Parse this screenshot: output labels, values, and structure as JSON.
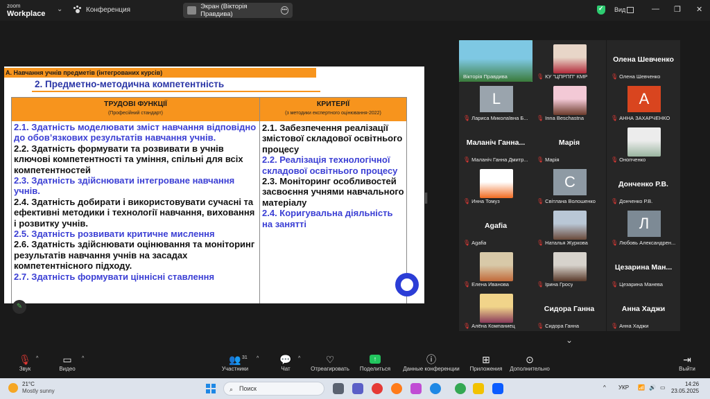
{
  "titlebar": {
    "brand_top": "zoom",
    "brand_bottom": "Workplace",
    "meeting_label": "Конференция",
    "screen_share_label": "Экран (Вікторія Правдива)",
    "view_label": "Вид"
  },
  "slide": {
    "section_title": "А. Навчання учнів предметів (інтегрованих курсів)",
    "subtitle": "2. Предметно-методична компетентність",
    "col1_header": "ТРУДОВІ ФУНКЦІЇ",
    "col1_subheader": "(Професійний стандарт)",
    "col2_header": "КРИТЕРІЇ",
    "col2_subheader": "(з методики експертного оцінювання-2022)",
    "functions": [
      {
        "text": "2.1. Здатність моделювати зміст навчання відповідно до обов’язкових результатів навчання учнів.",
        "color": "blue"
      },
      {
        "text": "2.2. Здатність формувати та розвивати в учнів ключові компетентності та уміння, спільні для всіх компетентностей",
        "color": "black"
      },
      {
        "text": "2.3. Здатність здійснювати інтегроване навчання учнів.",
        "color": "blue"
      },
      {
        "text": "2.4. Здатність добирати і використовувати сучасні та ефективні методики і технології навчання, виховання і розвитку учнів.",
        "color": "black"
      },
      {
        "text": "2.5. Здатність розвивати критичне мислення",
        "color": "blue"
      },
      {
        "text": "2.6. Здатність здійснювати оцінювання та моніторинг результатів навчання учнів на засадах компетентнісного підходу.",
        "color": "black"
      },
      {
        "text": "2.7. Здатність формувати ціннісні ставлення",
        "color": "blue"
      }
    ],
    "criteria": [
      {
        "text": "2.1. Забезпечення реалізації змістової складової освітнього процесу",
        "color": "black"
      },
      {
        "text": "2.2. Реалізація технологічної складової освітнього процесу",
        "color": "blue"
      },
      {
        "text": "2.3. Моніторинг особливостей засвоєння учнями навчального матеріалу",
        "color": "black"
      },
      {
        "text": "2.4. Коригувальна діяльність на занятті",
        "color": "blue"
      }
    ]
  },
  "participants": [
    {
      "name": "Вікторія Правдива",
      "type": "photo",
      "colors": [
        "#7ec8e3",
        "#3a7a3a"
      ],
      "active": true,
      "muted": false
    },
    {
      "name": "КУ \"ЦПРПП\" КМР",
      "type": "photo",
      "colors": [
        "#e8d6c8",
        "#b22a3a"
      ],
      "muted": true
    },
    {
      "name": "Олена Шевченко",
      "type": "name",
      "big": "Олена Шевченко",
      "muted": true
    },
    {
      "name": "Лариса Миколаївна Б...",
      "type": "letter",
      "letter": "L",
      "bg": "#9aa4ad",
      "muted": true
    },
    {
      "name": "Inna Beschastna",
      "type": "photo",
      "colors": [
        "#f3c9d6",
        "#6b3b2b"
      ],
      "muted": true
    },
    {
      "name": "АННА ЗАХАРЧЕНКО",
      "type": "letter",
      "letter": "A",
      "bg": "#d9451f",
      "muted": true
    },
    {
      "name": "Маланіч Ганна Дмитр...",
      "type": "name",
      "big": "Маланіч Ганна...",
      "muted": true
    },
    {
      "name": "Марія",
      "type": "name",
      "big": "Марія",
      "muted": true
    },
    {
      "name": "Онопченко",
      "type": "photo",
      "colors": [
        "#ececec",
        "#9ab5a0"
      ],
      "muted": true
    },
    {
      "name": "Инна Томуз",
      "type": "photo",
      "colors": [
        "#ffffff",
        "#f26b21"
      ],
      "muted": true
    },
    {
      "name": "Світлана Волошенко",
      "type": "letter",
      "letter": "C",
      "bg": "#8e9aa4",
      "muted": true
    },
    {
      "name": "Донченко Р.В.",
      "type": "name",
      "big": "Донченко Р.В.",
      "muted": true
    },
    {
      "name": "Agafia",
      "type": "name",
      "big": "Agafia",
      "muted": true
    },
    {
      "name": "Наталья Журкова",
      "type": "photo",
      "colors": [
        "#b9c7d6",
        "#6a4a3a"
      ],
      "muted": true
    },
    {
      "name": "Любовь Александрен...",
      "type": "letter",
      "letter": "Л",
      "bg": "#7d8a95",
      "muted": true
    },
    {
      "name": "Елена Иванова",
      "type": "photo",
      "colors": [
        "#d8c9a8",
        "#c26a3a"
      ],
      "muted": true
    },
    {
      "name": "Ірина Гросу",
      "type": "photo",
      "colors": [
        "#d7d3cc",
        "#5a3a2a"
      ],
      "muted": true
    },
    {
      "name": "Цезарина Манева",
      "type": "name",
      "big": "Цезарина Ман...",
      "muted": true
    },
    {
      "name": "Алёна Компаниец",
      "type": "photo",
      "colors": [
        "#f1d48a",
        "#8a3a5a"
      ],
      "muted": true
    },
    {
      "name": "Сидора Ганна",
      "type": "name",
      "big": "Сидора Ганна",
      "muted": true
    },
    {
      "name": "Анна Хаджи",
      "type": "name",
      "big": "Анна Хаджи",
      "muted": true
    }
  ],
  "toolbar": {
    "audio": "Звук",
    "video": "Видео",
    "participants": "Участники",
    "participants_count": "31",
    "chat": "Чат",
    "react": "Отреагировать",
    "share": "Поделиться",
    "info": "Данные конференции",
    "apps": "Приложения",
    "more": "Дополнительно",
    "leave": "Выйти"
  },
  "taskbar": {
    "temp": "21°C",
    "weather": "Mostly sunny",
    "search_placeholder": "Поиск",
    "lang": "УКР",
    "time": "14:26",
    "date": "23.05.2025"
  }
}
